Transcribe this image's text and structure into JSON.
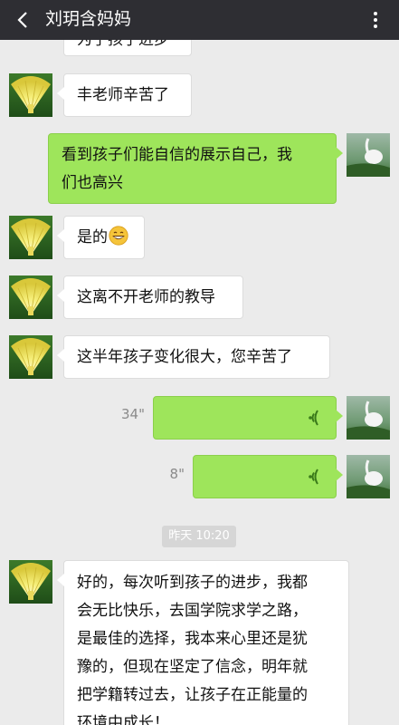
{
  "header": {
    "title": "刘玥含妈妈"
  },
  "messages": {
    "m0": "为了孩子进步",
    "m1": "丰老师辛苦了",
    "m2_line1": "看到孩子们能自信的展示自己，我",
    "m2_line2": "们也高兴",
    "m3": "是的",
    "m4": "这离不开老师的教导",
    "m5": "这半年孩子变化很大，您辛苦了",
    "voice1_duration": "34\"",
    "voice2_duration": "8\"",
    "timestamp": "昨天 10:20",
    "m8_line1": "好的，每次听到孩子的进步，我都",
    "m8_line2": "会无比快乐，去国学院求学之路，",
    "m8_line3": "是最佳的选择，我本来心里还是犹",
    "m8_line4": "豫的，但现在坚定了信念，明年就",
    "m8_line5": "把学籍转过去，让孩子在正能量的",
    "m8_line6": "环境中成长！"
  },
  "colors": {
    "header_bg": "#2e2e33",
    "chat_bg": "#ebebeb",
    "outgoing_bubble": "#9ee55b",
    "incoming_bubble": "#ffffff"
  },
  "icons": {
    "back": "chevron-left-icon",
    "more": "more-vertical-icon",
    "voice": "voice-wave-icon",
    "emoji": "grinning-face-emoji"
  }
}
